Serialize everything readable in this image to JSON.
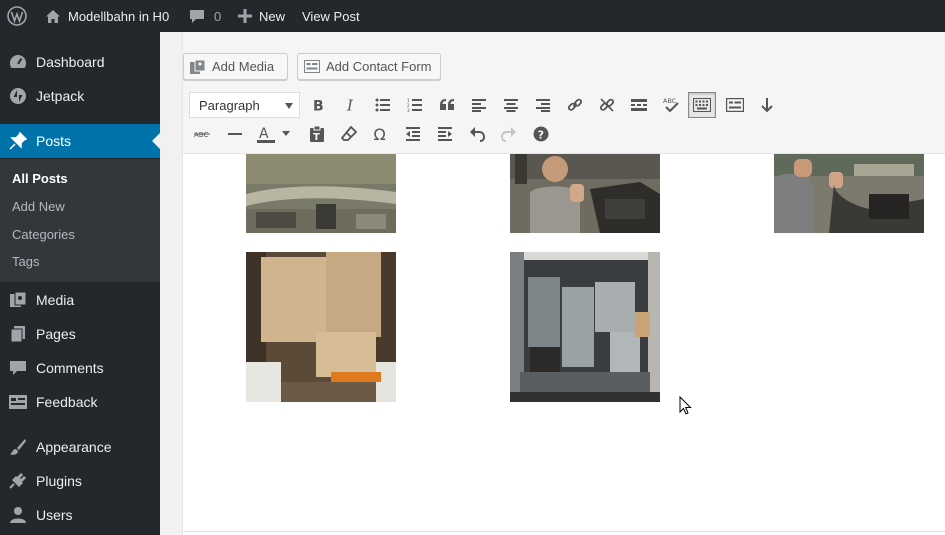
{
  "adminbar": {
    "site_name": "Modellbahn in H0",
    "comments_count": "0",
    "new_label": "New",
    "view_post_label": "View Post"
  },
  "sidebar": {
    "items": [
      {
        "label": "Dashboard",
        "icon": "dashboard-icon"
      },
      {
        "label": "Jetpack",
        "icon": "jetpack-icon"
      },
      {
        "label": "Posts",
        "icon": "pin-icon",
        "current": true
      },
      {
        "label": "Media",
        "icon": "media-icon"
      },
      {
        "label": "Pages",
        "icon": "pages-icon"
      },
      {
        "label": "Comments",
        "icon": "comment-icon"
      },
      {
        "label": "Feedback",
        "icon": "feedback-icon"
      },
      {
        "label": "Appearance",
        "icon": "brush-icon"
      },
      {
        "label": "Plugins",
        "icon": "plugin-icon"
      },
      {
        "label": "Users",
        "icon": "user-icon"
      }
    ],
    "posts_submenu": [
      {
        "label": "All Posts",
        "current": true
      },
      {
        "label": "Add New"
      },
      {
        "label": "Categories"
      },
      {
        "label": "Tags"
      }
    ]
  },
  "editor": {
    "add_media_label": "Add Media",
    "add_contact_form_label": "Add Contact Form",
    "format_select": "Paragraph"
  },
  "colors": {
    "admin_dark": "#23282d",
    "accent": "#0073aa",
    "submenu_bg": "#32373c"
  }
}
